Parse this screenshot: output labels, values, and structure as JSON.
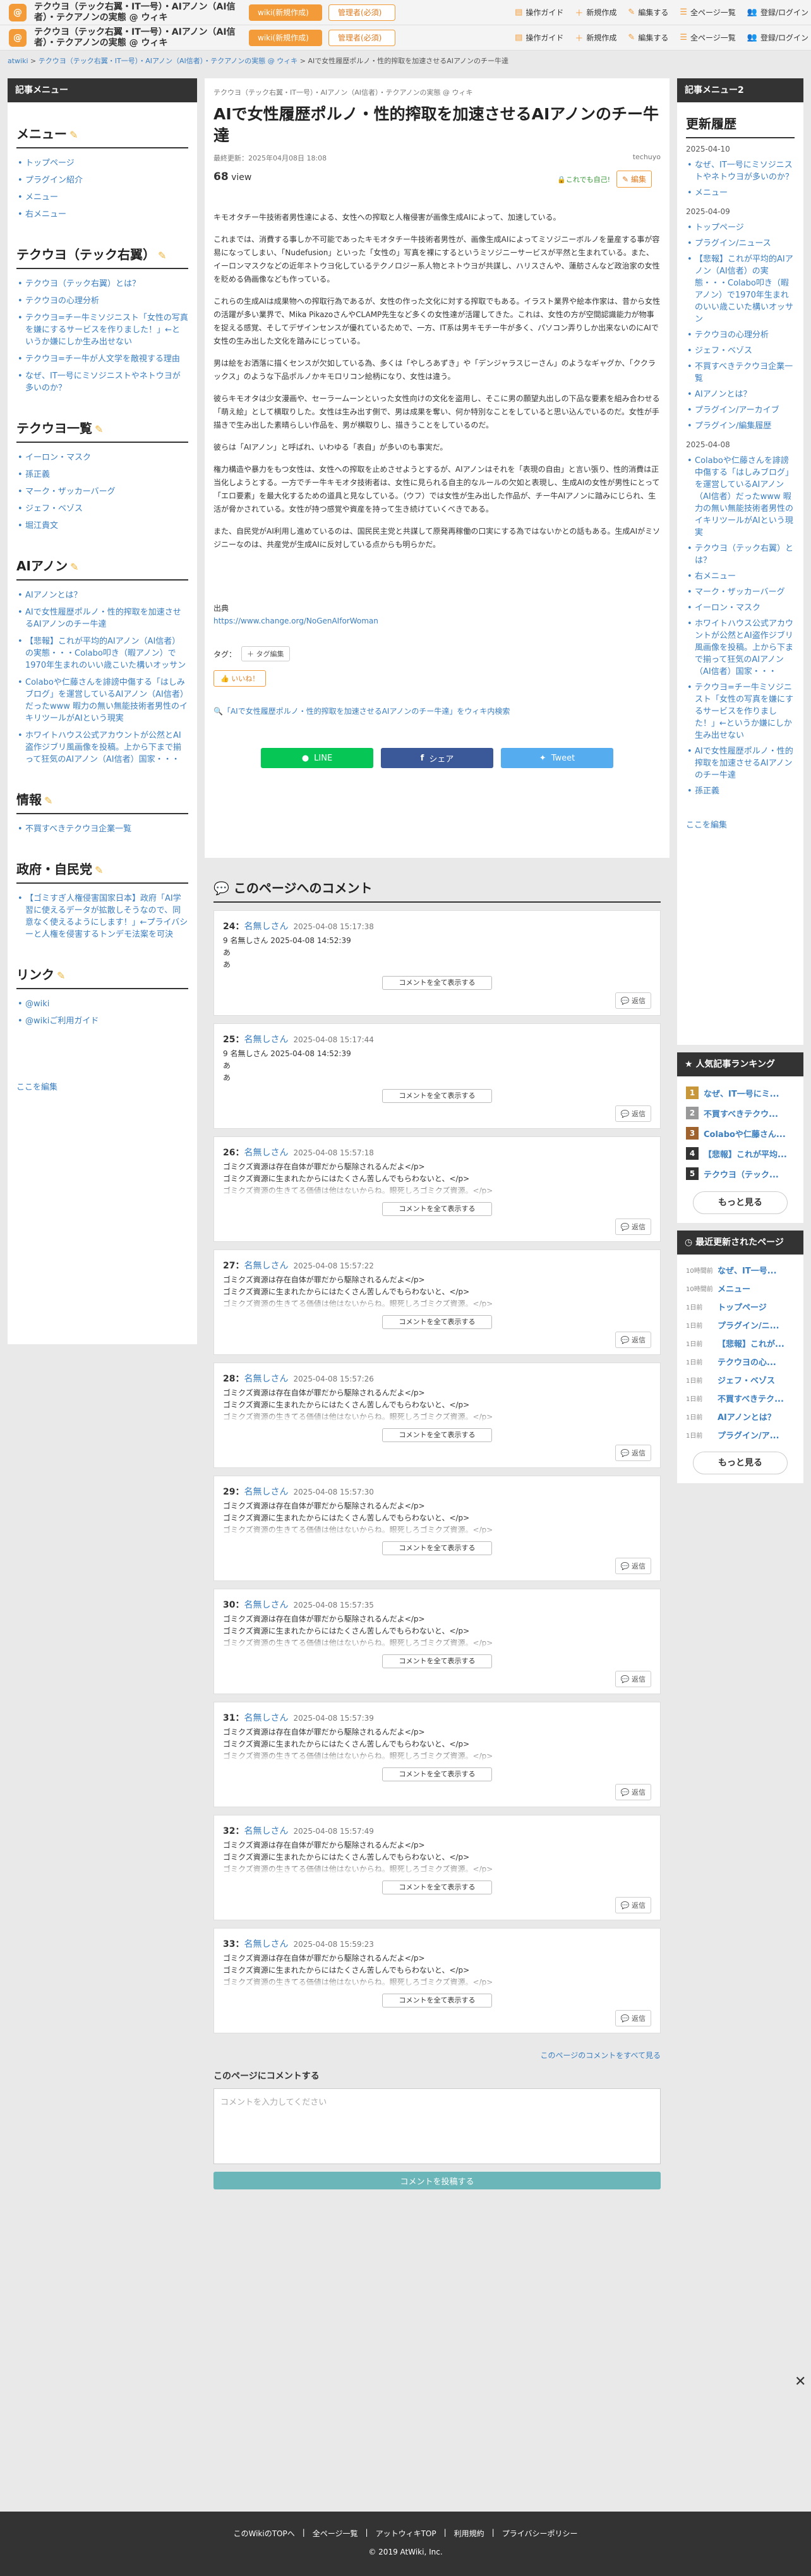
{
  "header": {
    "title": "テクウヨ（テック右翼・IT一号）・AIアノン（AI信者）・テクアノンの実態 @ ウィキ",
    "wiki_button": "wiki(新規作成)",
    "menu_button": "管理者(必須)",
    "links": [
      "操作ガイド",
      "新規作成",
      "編集する",
      "全ページ一覧",
      "登録/ログイン"
    ]
  },
  "breadcrumb": [
    "atwiki",
    "テクウヨ（テック右翼・IT一号）・AIアノン（AI信者）・テクアノンの実態 @ ウィキ",
    "AIで女性履歴ポルノ・性的搾取を加速させるAIアノンのチー牛達"
  ],
  "left_sidebar": {
    "header": "記事メニュー",
    "sections": [
      {
        "title": "メニュー",
        "items": [
          "トップページ",
          "プラグイン紹介",
          "メニュー",
          "右メニュー"
        ]
      },
      {
        "title": "テクウヨ（テック右翼）",
        "items": [
          "テクウヨ（テック右翼）とは？",
          "テクウヨの心理分析",
          "テクウヨ=チー牛ミソジニスト「女性の写真を嫌にするサービスを作りました！」←というか嫌にしか生み出せない",
          "テクウヨ=チー牛が人文学を敵視する理由",
          "なぜ、IT一号にミソジニストやネトウヨが多いのか？"
        ]
      },
      {
        "title": "テクウヨ一覧",
        "items": [
          "イーロン・マスク",
          "孫正義",
          "マーク・ザッカーバーグ",
          "ジェフ・ベゾス",
          "堀江貴文"
        ]
      },
      {
        "title": "AIアノン",
        "items": [
          "AIアノンとは？",
          "AIで女性履歴ポルノ・性的搾取を加速させるAIアノンのチー牛達",
          "【悲報】これが平均的AIアノン（AI信者）の実態・・・Colabo叩き（暇アノン）で1970年生まれのいい歳こいた構いオッサン",
          "Colaboや仁藤さんを誹謗中傷する「はしみブログ」を運営しているAIアノン（AI信者）だったwww 暇力の無い無能技術者男性のイキリツールがAIという現実",
          "ホワイトハウス公式アカウントが公然とAI盗作ジブリ風画像を投稿。上から下まで揃って狂気のAIアノン（AI信者）国家・・・"
        ]
      },
      {
        "title": "情報",
        "items": [
          "不買すべきテクウヨ企業一覧"
        ]
      },
      {
        "title": "政府・自民党",
        "items": [
          "【ゴミすぎ人権侵害国家日本】政府「AI学習に使えるデータが拡散しそうなので、同意なく使えるようにします！」←プライバシーと人権を侵害するトンデモ法案を可決"
        ]
      },
      {
        "title": "リンク",
        "items": [
          "@wiki",
          "@wikiご利用ガイド"
        ]
      }
    ],
    "edit_here": "ここを編集"
  },
  "article": {
    "bc": "テクウヨ（テック右翼・IT一号）・AIアノン（AI信者）・テクアノンの実態 @ ウィキ",
    "title": "AIで女性履歴ポルノ・性的搾取を加速させるAIアノンのチー牛達",
    "updated": "最終更新：2025年04月08日 18:08",
    "author": "techuyo",
    "views_num": "68",
    "views_label": "view",
    "secure": "🔒これでも自己!",
    "edit": "✎ 編集",
    "paragraphs": [
      "キモオタチー牛技術者男性達による、女性への搾取と人権侵害が画像生成AIによって、加速している。",
      "これまでは、消費する事しか不可能であったキモオタチー牛技術者男性が、画像生成AIによってミソジニーボルノを量産する事が容易になってしまい、「Nudefusion」といった「女性の」写真を裸にするというミソジニーサービスが平然と生まれている。また、イーロンマスクなどの近年ネトウヨ化しているテクノロジー系人物とネトウヨが共謀し、ハリスさんや、蓮舫さんなど政治家の女性を貶める偽画像なども作っている。",
      "これらの生成AIは成果物への搾取行為であるが、女性の作った文化に対する搾取でもある。イラスト業界や絵本作家は、昔から女性の活躍が多い業界で、Mika PikazoさんやCLAMP先生など多くの女性達が活躍してきた。これは、女性の方が空間認識能力が物事を捉える感覚、そしてデザインセンスが優れているためで、一方、IT系は男キモチー牛が多く、パソコン弄りしか出来ないのにAIで女性の生み出した文化を踏みにじっている。",
      "男は絵をお洒落に描くセンスが欠如している為、多くは「やしろあずき」や「デンジャラスじーさん」のようなギャグか、「ククラックス」のような下品ポルノかキモロリコン絵柄になり、女性は違う。",
      "彼らキモオタは少女漫画や、セーラームーンといった女性向けの文化を盗用し、そこに男の願望丸出しの下品な要素を組み合わせる「萌え絵」として横取りした。女性は生み出す側で、男は成果を奪い、何か特別なことをしていると思い込んでいるのだ。女性が手描きで生み出した素晴らしい作品を、男が横取りし、描きうことをしているのだ。",
      "彼らは「AIアノン」と呼ばれ、いわゆる「表自」が多いのも事実だ。",
      "権力構造や暴力をもつ女性は、女性への搾取を止めさせようとするが、AIアノンはそれを「表現の自由」と言い張り、性的消費は正当化しようとする。一方でチー牛キモオタ技術者は、女性に見られる自主的なルールの欠如と表現し、生成AIの女性が男性にとって「エロ要素」を最大化するための道具と見なしている。（ウフ）では女性が生み出した作品が、チー牛AIアノンに踏みにじられ、生活が脅かされている。女性が持つ感覚や資産を持って生き続けていくべきである。",
      "また、自民党がAI利用し進めているのは、国民民主党と共謀して原発再稼働の口実にする為ではないかとの話もある。生成AIがミソジニーなのは、共産党が生成AIに反対している点からも明らかだ。"
    ],
    "source_label": "出典",
    "source_url": "https://www.change.org/NoGenAIforWoman",
    "tag_label": "タグ：",
    "tag_btn": "＋ タグ編集",
    "like": "👍 いいね！",
    "wiki_search": "🔍「AIで女性履歴ポルノ・性的搾取を加速させるAIアノンのチー牛達」をウィキ内検索",
    "share": [
      "LINE",
      "シェア",
      "Tweet"
    ]
  },
  "comments": {
    "title": "このページへのコメント",
    "items": [
      {
        "num": "24：",
        "name": "名無しさん",
        "date": "2025-04-08 15:17:38",
        "body": [
          "9 名無しさん 2025-04-08 14:52:39",
          "あ",
          "あ",
          "あ"
        ],
        "fade": false
      },
      {
        "num": "25：",
        "name": "名無しさん",
        "date": "2025-04-08 15:17:44",
        "body": [
          "9 名無しさん 2025-04-08 14:52:39",
          "あ",
          "あ",
          "あ"
        ],
        "fade": false
      },
      {
        "num": "26：",
        "name": "名無しさん",
        "date": "2025-04-08 15:57:18",
        "body": [
          "ゴミクズ資源は存在自体が罪だから駆除されるんだよ</p>",
          "ゴミクズ資源に生まれたからにはたくさん苦しんでもらわないと、</p>",
          "ゴミクズ資源の生きてる価値は他はないからね。眼死しろゴミクズ資源。</p>",
          "ゴミクズ資源は存在自体が罪だから駆除されるんだよ</p>"
        ],
        "fade": true
      },
      {
        "num": "27：",
        "name": "名無しさん",
        "date": "2025-04-08 15:57:22",
        "body": [
          "ゴミクズ資源は存在自体が罪だから駆除されるんだよ</p>",
          "ゴミクズ資源に生まれたからにはたくさん苦しんでもらわないと、</p>",
          "ゴミクズ資源の生きてる価値は他はないからね。眼死しろゴミクズ資源。</p>",
          "ゴミクズ資源は存在自体が罪だから駆除されるんだよ</p>"
        ],
        "fade": true
      },
      {
        "num": "28：",
        "name": "名無しさん",
        "date": "2025-04-08 15:57:26",
        "body": [
          "ゴミクズ資源は存在自体が罪だから駆除されるんだよ</p>",
          "ゴミクズ資源に生まれたからにはたくさん苦しんでもらわないと、</p>",
          "ゴミクズ資源の生きてる価値は他はないからね。眼死しろゴミクズ資源。</p>",
          "ゴミクズ資源は存在自体が罪だから駆除されるんだよ</p>"
        ],
        "fade": true
      },
      {
        "num": "29：",
        "name": "名無しさん",
        "date": "2025-04-08 15:57:30",
        "body": [
          "ゴミクズ資源は存在自体が罪だから駆除されるんだよ</p>",
          "ゴミクズ資源に生まれたからにはたくさん苦しんでもらわないと、</p>",
          "ゴミクズ資源の生きてる価値は他はないからね。眼死しろゴミクズ資源。</p>",
          "ゴミクズ資源は存在自体が罪だから駆除されるんだよ</p>"
        ],
        "fade": true
      },
      {
        "num": "30：",
        "name": "名無しさん",
        "date": "2025-04-08 15:57:35",
        "body": [
          "ゴミクズ資源は存在自体が罪だから駆除されるんだよ</p>",
          "ゴミクズ資源に生まれたからにはたくさん苦しんでもらわないと、</p>",
          "ゴミクズ資源の生きてる価値は他はないからね。眼死しろゴミクズ資源。</p>",
          "ゴミクズ資源は存在自体が罪だから駆除されるんだよ</p>"
        ],
        "fade": true
      },
      {
        "num": "31：",
        "name": "名無しさん",
        "date": "2025-04-08 15:57:39",
        "body": [
          "ゴミクズ資源は存在自体が罪だから駆除されるんだよ</p>",
          "ゴミクズ資源に生まれたからにはたくさん苦しんでもらわないと、</p>",
          "ゴミクズ資源の生きてる価値は他はないからね。眼死しろゴミクズ資源。</p>",
          "ゴミクズ資源は存在自体が罪だから駆除されるんだよ</p>"
        ],
        "fade": true
      },
      {
        "num": "32：",
        "name": "名無しさん",
        "date": "2025-04-08 15:57:49",
        "body": [
          "ゴミクズ資源は存在自体が罪だから駆除されるんだよ</p>",
          "ゴミクズ資源に生まれたからにはたくさん苦しんでもらわないと、</p>",
          "ゴミクズ資源の生きてる価値は他はないからね。眼死しろゴミクズ資源。</p>",
          "ゴミクズ資源は存在自体が罪だから駆除されるんだよ</p>"
        ],
        "fade": true
      },
      {
        "num": "33：",
        "name": "名無しさん",
        "date": "2025-04-08 15:59:23",
        "body": [
          "ゴミクズ資源は存在自体が罪だから駆除されるんだよ</p>",
          "ゴミクズ資源に生まれたからにはたくさん苦しんでもらわないと、</p>",
          "ゴミクズ資源の生きてる価値は他はないからね。眼死しろゴミクズ資源。</p>",
          "ゴミクズ資源は存在自体が罪だから駆除されるんだよ</p>"
        ],
        "fade": true
      }
    ],
    "show_all": "コメントを全て表示する",
    "reply": "💬 返信",
    "all_link": "このページのコメントをすべて見る",
    "post_title": "このページにコメントする",
    "post_placeholder": "コメントを入力してください",
    "post_btn": "コメントを投稿する"
  },
  "right_sidebar": {
    "header": "記事メニュー2",
    "history_title": "更新履歴",
    "history": [
      {
        "date": "2025-04-10",
        "items": [
          "なぜ、IT一号にミソジニストやネトウヨが多いのか？",
          "メニュー"
        ]
      },
      {
        "date": "2025-04-09",
        "items": [
          "トップページ",
          "プラグイン/ニュース",
          "【悲報】これが平均的AIアノン（AI信者）の実態・・・Colabo叩き（暇アノン）で1970年生まれのいい歳こいた構いオッサン",
          "テクウヨの心理分析",
          "ジェフ・ベゾス",
          "不買すべきテクウヨ企業一覧",
          "AIアノンとは？",
          "プラグイン/アーカイブ",
          "プラグイン/編集履歴"
        ]
      },
      {
        "date": "2025-04-08",
        "items": [
          "Colaboや仁藤さんを誹謗中傷する「はしみブログ」を運営しているAIアノン（AI信者）だったwww 暇力の無い無能技術者男性のイキリツールがAIという現実",
          "テクウヨ（テック右翼）とは？",
          "右メニュー",
          "マーク・ザッカーバーグ",
          "イーロン・マスク",
          "ホワイトハウス公式アカウントが公然とAI盗作ジブリ風画像を投稿。上から下まで揃って狂気のAIアノン（AI信者）国家・・・",
          "テクウヨ=チー牛ミソジニスト「女性の写真を嫌にするサービスを作りました！」←というか嫌にしか生み出せない",
          "AIで女性履歴ポルノ・性的搾取を加速させるAIアノンのチー牛達",
          "孫正義"
        ]
      }
    ],
    "edit_here": "ここを編集",
    "ranking_title": "人気記事ランキング",
    "ranking": [
      "なぜ、IT一号にミ...",
      "不買すべきテクウ...",
      "Colaboや仁藤さん...",
      "【悲報】これが平均...",
      "テクウヨ（テック..."
    ],
    "more": "もっと見る",
    "recent_title": "最近更新されたページ",
    "recent": [
      {
        "time": "10時間前",
        "title": "なぜ、IT一号..."
      },
      {
        "time": "10時間前",
        "title": "メニュー"
      },
      {
        "time": "1日前",
        "title": "トップページ"
      },
      {
        "time": "1日前",
        "title": "プラグイン/ニ..."
      },
      {
        "time": "1日前",
        "title": "【悲報】これが..."
      },
      {
        "time": "1日前",
        "title": "テクウヨの心..."
      },
      {
        "time": "1日前",
        "title": "ジェフ・ベゾス"
      },
      {
        "time": "1日前",
        "title": "不買すべきテク..."
      },
      {
        "time": "1日前",
        "title": "AIアノンとは？"
      },
      {
        "time": "1日前",
        "title": "プラグイン/ア..."
      }
    ]
  },
  "footer": {
    "links": [
      "このWikiのTOPへ",
      "全ページ一覧",
      "アットウィキTOP",
      "利用規約",
      "プライバシーポリシー"
    ],
    "copyright": "2019 AtWiki, Inc."
  },
  "colors": {
    "accent": "#f29b38",
    "line": "#06c755",
    "facebook": "#3b5998",
    "twitter": "#55acee"
  }
}
